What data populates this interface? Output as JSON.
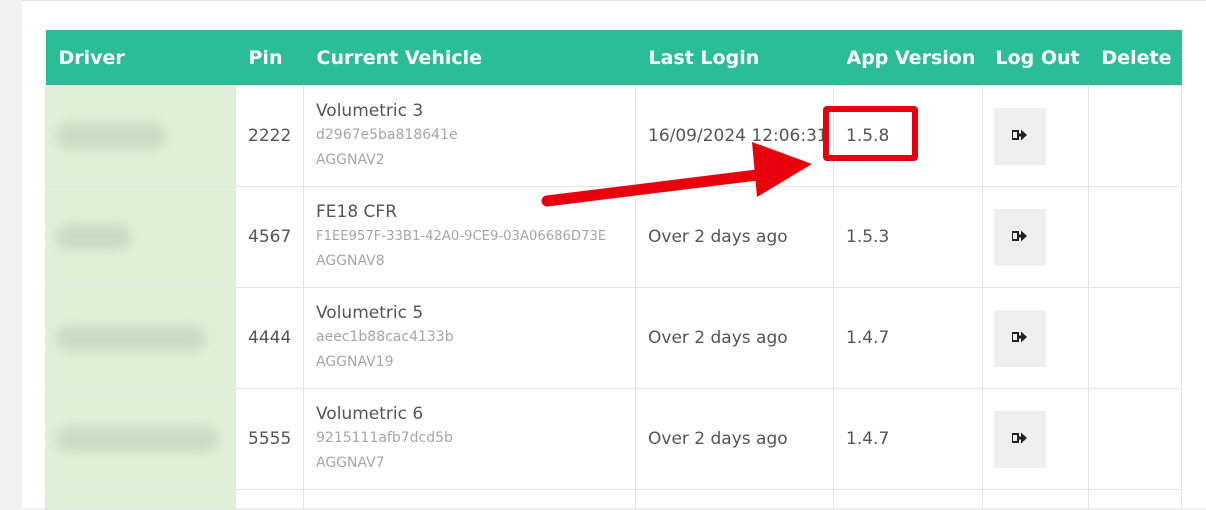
{
  "table": {
    "headers": {
      "driver": "Driver",
      "pin": "Pin",
      "vehicle": "Current Vehicle",
      "last_login": "Last Login",
      "app_version": "App Version",
      "log_out": "Log Out",
      "delete": "Delete"
    },
    "rows": [
      {
        "pin": "2222",
        "vehicle_name": "Volumetric 3",
        "vehicle_id": "d2967e5ba818641e",
        "vehicle_code": "AGGNAV2",
        "last_login": "16/09/2024 12:06:31",
        "app_version": "1.5.8"
      },
      {
        "pin": "4567",
        "vehicle_name": "FE18 CFR",
        "vehicle_id": "F1EE957F-33B1-42A0-9CE9-03A06686D73E",
        "vehicle_code": "AGGNAV8",
        "last_login": "Over 2 days ago",
        "app_version": "1.5.3"
      },
      {
        "pin": "4444",
        "vehicle_name": "Volumetric 5",
        "vehicle_id": "aeec1b88cac4133b",
        "vehicle_code": "AGGNAV19",
        "last_login": "Over 2 days ago",
        "app_version": "1.4.7"
      },
      {
        "pin": "5555",
        "vehicle_name": "Volumetric 6",
        "vehicle_id": "9215111afb7dcd5b",
        "vehicle_code": "AGGNAV7",
        "last_login": "Over 2 days ago",
        "app_version": "1.4.7"
      }
    ]
  },
  "icons": {
    "logout": "sign-out-icon"
  },
  "colors": {
    "header_bg": "#2bbd97",
    "driver_cell_bg": "#dff0d8",
    "annotation": "#e8000c"
  }
}
